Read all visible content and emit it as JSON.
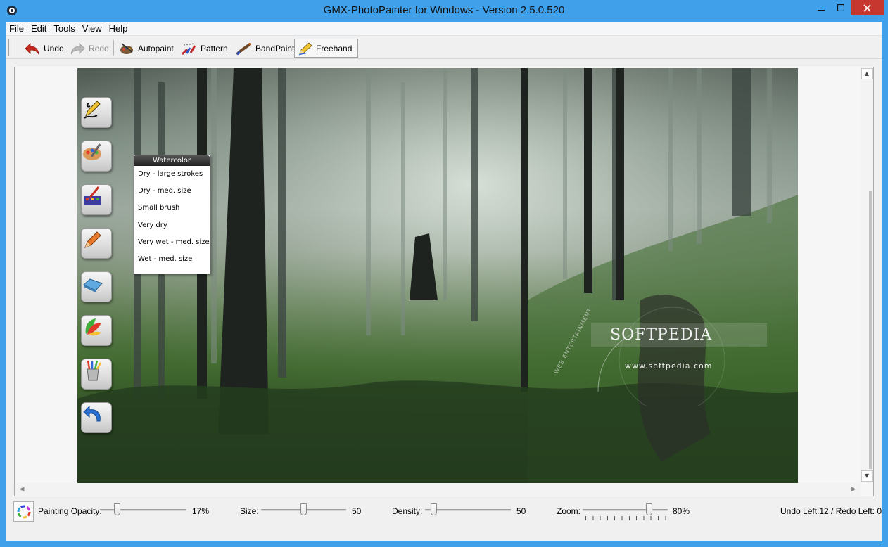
{
  "window": {
    "title": "GMX-PhotoPainter for Windows - Version 2.5.0.520"
  },
  "menu": {
    "items": [
      "File",
      "Edit",
      "Tools",
      "View",
      "Help"
    ]
  },
  "toolbar": {
    "undo_label": "Undo",
    "redo_label": "Redo",
    "autopaint_label": "Autopaint",
    "pattern_label": "Pattern",
    "bandpaint_label": "BandPaint",
    "freehand_label": "Freehand"
  },
  "popup": {
    "title": "Watercolor",
    "items": [
      "Dry - large strokes",
      "Dry - med. size",
      "Small brush",
      "Very dry",
      "Very wet  - med. size",
      "Wet  - med. size"
    ]
  },
  "watermark": {
    "brand": "SOFTPEDIA",
    "url": "www.softpedia.com",
    "arc_text": "WEB ENTERTAINMENT"
  },
  "status": {
    "opacity_label": "Painting Opacity:",
    "opacity_value": "17%",
    "opacity_level": 0.17,
    "size_label": "Size:",
    "size_value": "50",
    "size_level": 0.5,
    "density_label": "Density:",
    "density_value": "50",
    "density_level": 0.07,
    "zoom_label": "Zoom:",
    "zoom_value": "80%",
    "zoom_level": 0.8,
    "undo_redo": "Undo Left:12 / Redo Left: 0"
  },
  "colors": {
    "titlebar": "#41a0ea",
    "close": "#c7372f",
    "forest_dark": "#2f4726"
  }
}
